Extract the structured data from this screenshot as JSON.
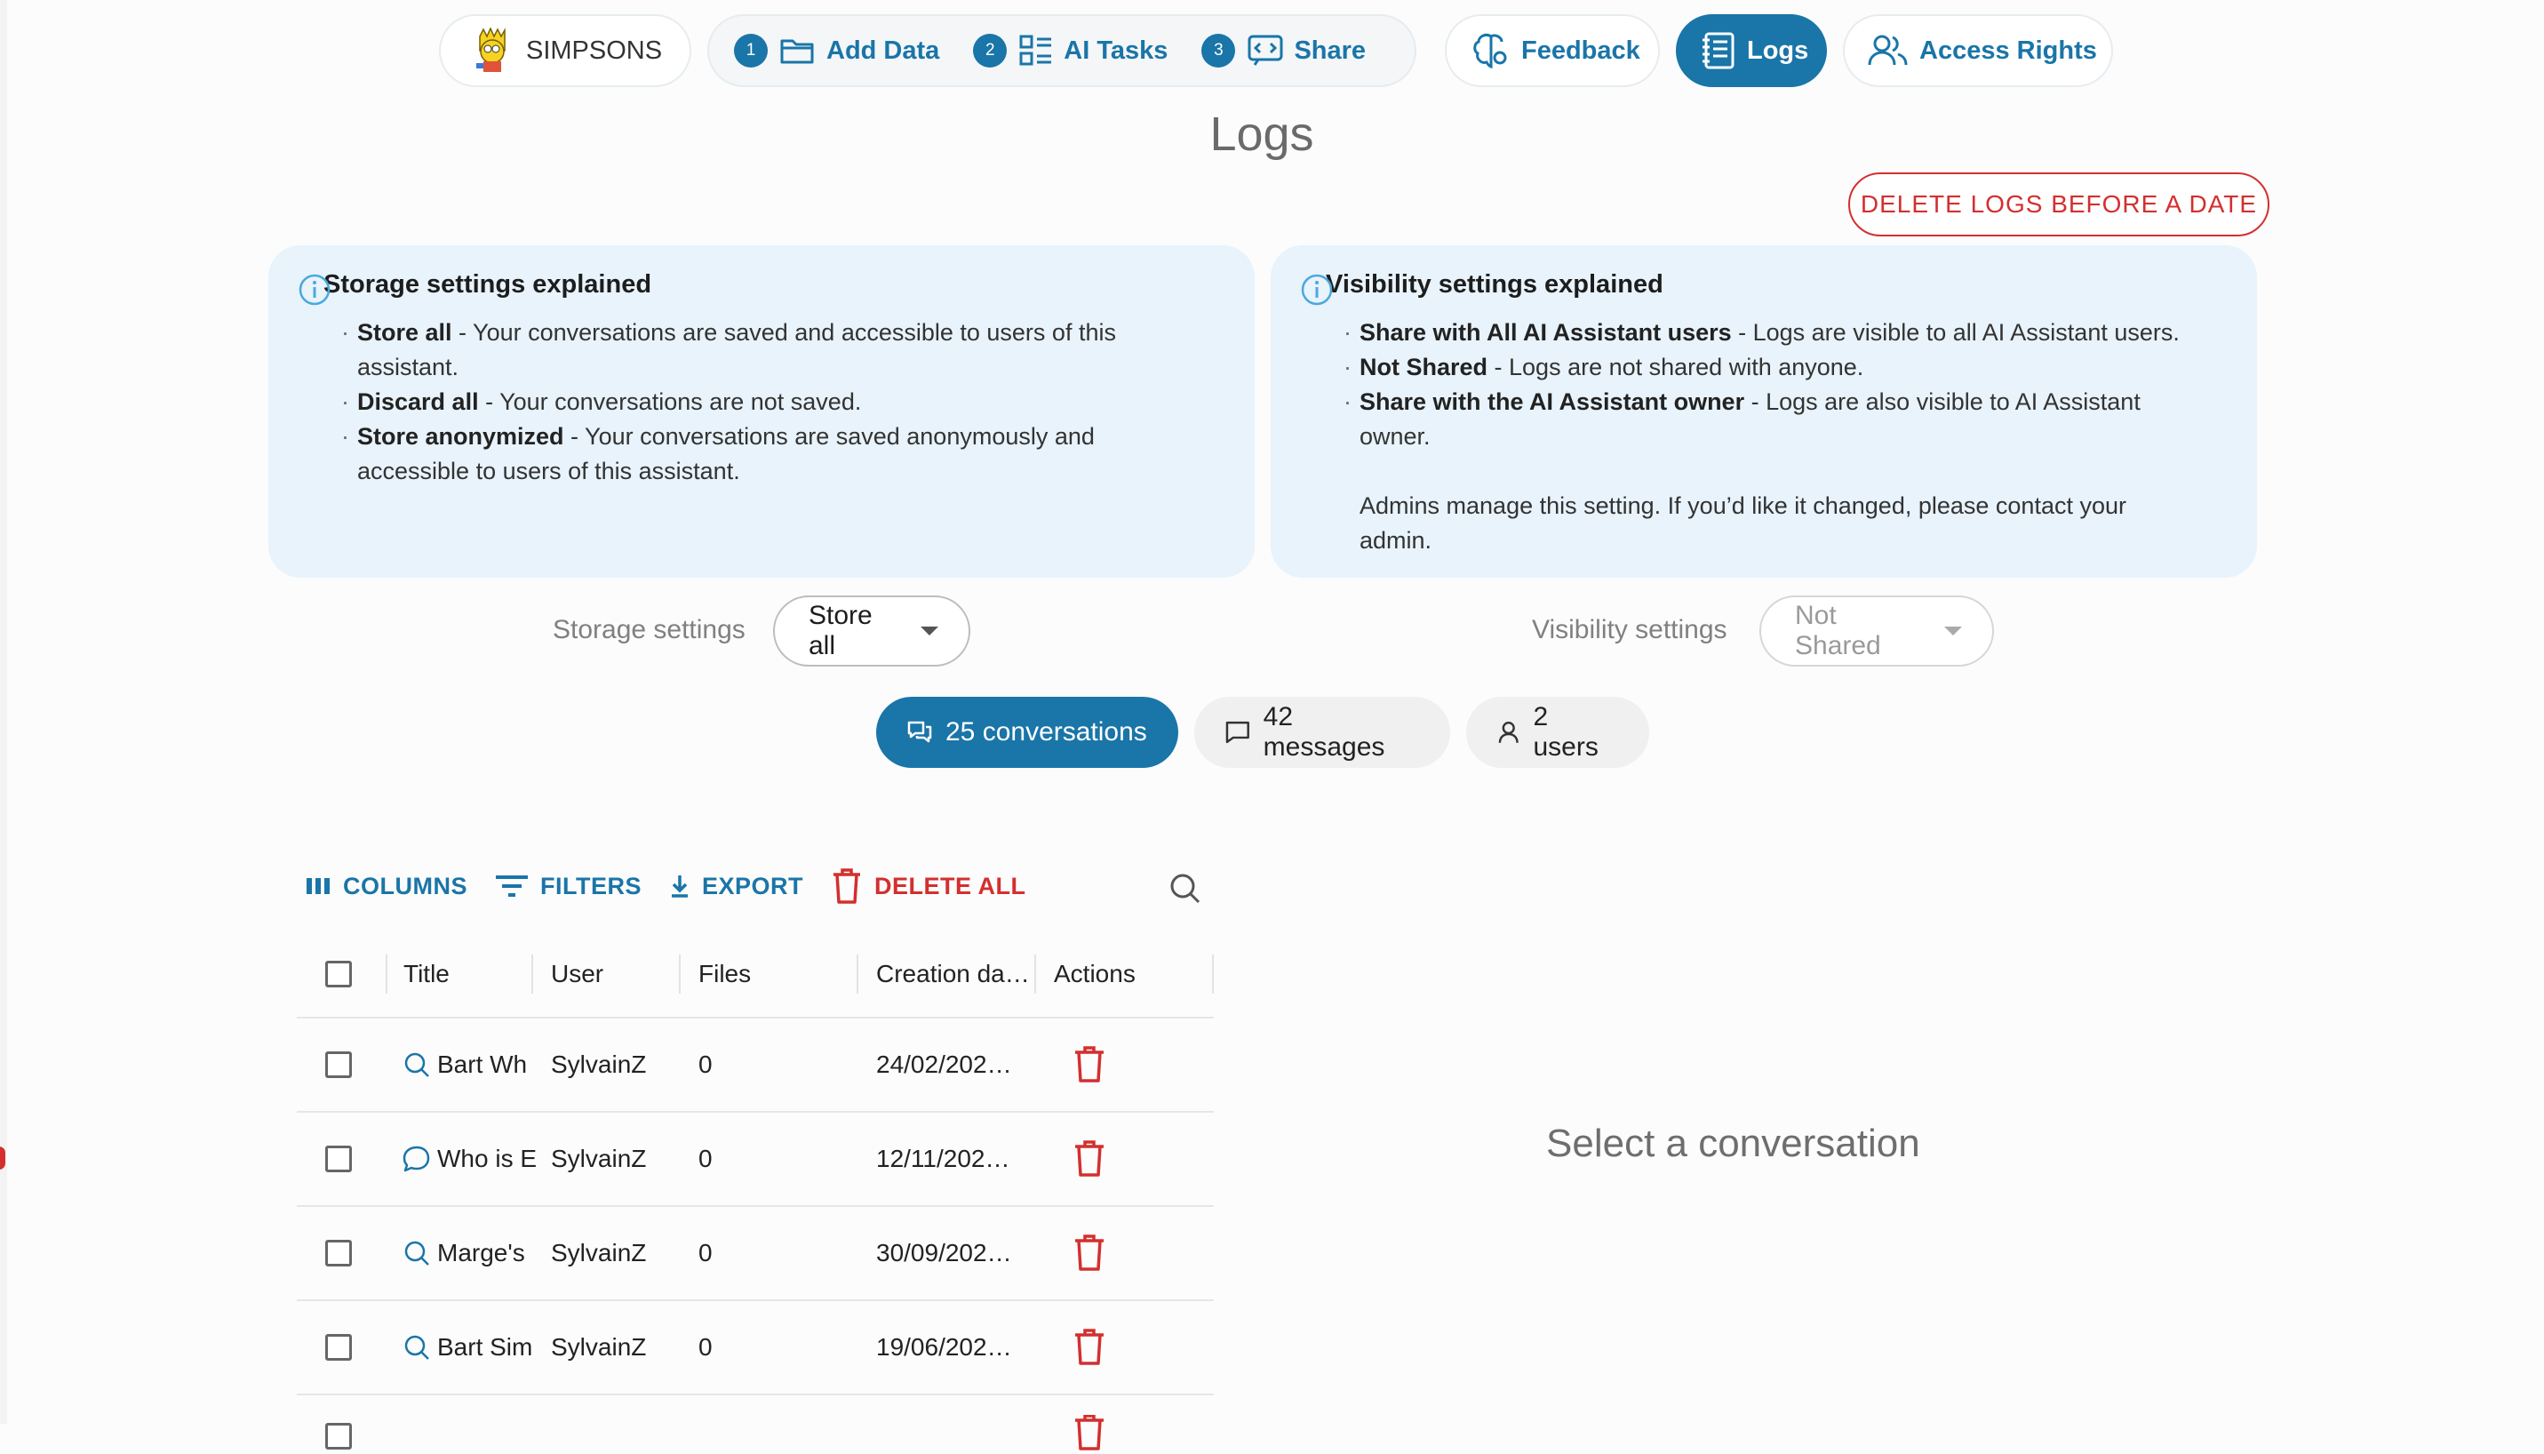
{
  "nav": {
    "assistant_name": "SIMPSONS",
    "steps": [
      {
        "num": "1",
        "label": "Add Data"
      },
      {
        "num": "2",
        "label": "AI Tasks"
      },
      {
        "num": "3",
        "label": "Share"
      }
    ],
    "feedback": "Feedback",
    "logs": "Logs",
    "access_rights": "Access Rights"
  },
  "page_title": "Logs",
  "delete_before_date": "DELETE LOGS BEFORE A DATE",
  "storage_info": {
    "title": "Storage settings explained",
    "items": [
      {
        "term": "Store all",
        "desc": " - Your conversations are saved and accessible to users of this",
        "desc2": "assistant."
      },
      {
        "term": "Discard all",
        "desc": " - Your conversations are not saved."
      },
      {
        "term": "Store anonymized",
        "desc": " - Your conversations are saved anonymously and",
        "desc2": "accessible to users of this assistant."
      }
    ]
  },
  "visibility_info": {
    "title": "Visibility settings explained",
    "items": [
      {
        "term": "Share with All AI Assistant users",
        "desc": " - Logs are visible to all AI Assistant users."
      },
      {
        "term": "Not Shared",
        "desc": " - Logs are not shared with anyone."
      },
      {
        "term": "Share with the AI Assistant owner",
        "desc": " - Logs are also visible to AI Assistant",
        "desc2": "owner."
      }
    ],
    "note_line1": "Admins manage this setting. If you’d like it changed, please contact your",
    "note_line2": "admin."
  },
  "storage_setting": {
    "label": "Storage settings",
    "value": "Store all"
  },
  "visibility_setting": {
    "label": "Visibility settings",
    "value": "Not Shared"
  },
  "chips": {
    "conversations": "25 conversations",
    "messages": "42 messages",
    "users": "2 users"
  },
  "toolbar": {
    "columns": "COLUMNS",
    "filters": "FILTERS",
    "export": "EXPORT",
    "delete_all": "DELETE ALL"
  },
  "table": {
    "headers": [
      "Title",
      "User",
      "Files",
      "Creation da…",
      "Actions"
    ],
    "rows": [
      {
        "icon": "search",
        "title": "Bart Wh",
        "user": "SylvainZ",
        "files": "0",
        "date": "24/02/202…"
      },
      {
        "icon": "chat",
        "title": "Who is E",
        "user": "SylvainZ",
        "files": "0",
        "date": "12/11/202…"
      },
      {
        "icon": "search",
        "title": "Marge's",
        "user": "SylvainZ",
        "files": "0",
        "date": "30/09/202…"
      },
      {
        "icon": "search",
        "title": "Bart Sim",
        "user": "SylvainZ",
        "files": "0",
        "date": "19/06/202…"
      }
    ]
  },
  "empty_state": "Select a conversation",
  "colors": {
    "primary": "#1a75a8",
    "danger": "#d32f2f",
    "info_bg": "#e8f3fb"
  }
}
